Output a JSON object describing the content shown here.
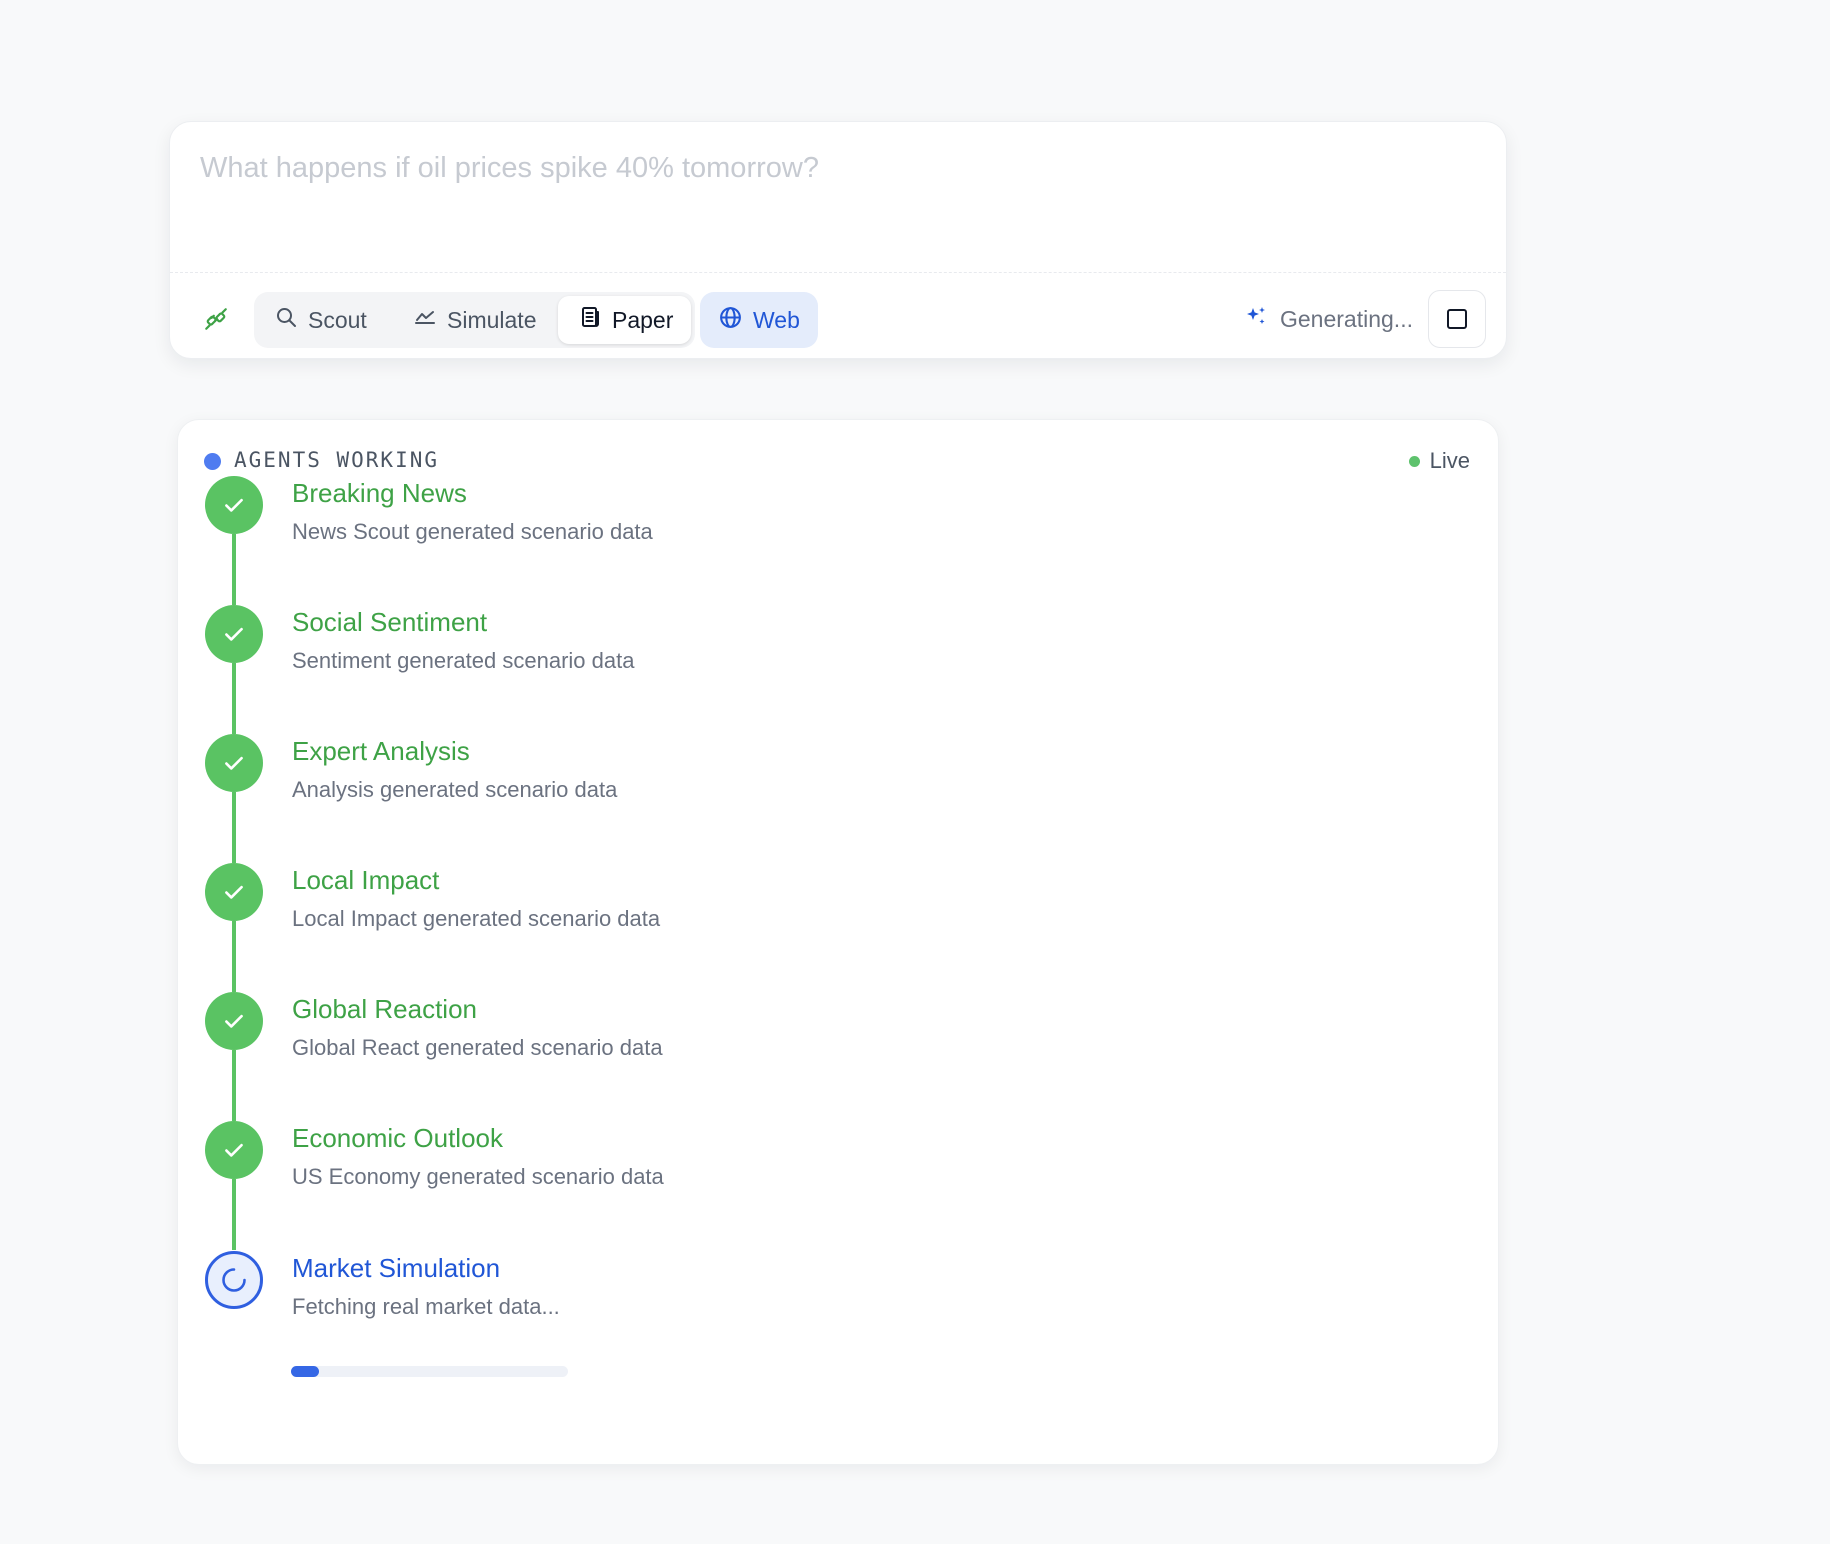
{
  "composer": {
    "placeholder": "What happens if oil prices spike 40% tomorrow?",
    "modes": [
      {
        "label": "Scout",
        "icon": "search-icon",
        "selected": false
      },
      {
        "label": "Simulate",
        "icon": "line-chart-icon",
        "selected": false
      },
      {
        "label": "Paper",
        "icon": "document-icon",
        "selected": true
      }
    ],
    "web": {
      "label": "Web",
      "icon": "globe-icon",
      "enabled": true
    },
    "status": {
      "label": "Generating...",
      "icon": "sparkles-icon"
    },
    "stop_icon": "stop-icon",
    "attach_icon": "plug-icon"
  },
  "agents": {
    "title": "AGENTS WORKING",
    "live_label": "Live",
    "steps": [
      {
        "title": "Breaking News",
        "desc": "News Scout generated scenario data",
        "status": "done"
      },
      {
        "title": "Social Sentiment",
        "desc": "Sentiment generated scenario data",
        "status": "done"
      },
      {
        "title": "Expert Analysis",
        "desc": "Analysis generated scenario data",
        "status": "done"
      },
      {
        "title": "Local Impact",
        "desc": "Local Impact generated scenario data",
        "status": "done"
      },
      {
        "title": "Global Reaction",
        "desc": "Global React generated scenario data",
        "status": "done"
      },
      {
        "title": "Economic Outlook",
        "desc": "US Economy generated scenario data",
        "status": "done"
      },
      {
        "title": "Market Simulation",
        "desc": "Fetching real market data...",
        "status": "active",
        "progress": 0.1
      }
    ]
  },
  "colors": {
    "done": "#5ac363",
    "done_text": "#3ea246",
    "active": "#2056d6",
    "accent_blue": "#4f7cf0"
  }
}
